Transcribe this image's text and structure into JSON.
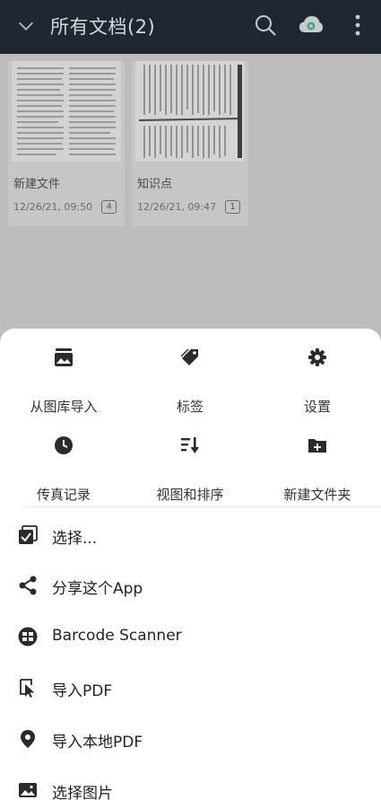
{
  "header": {
    "title": "所有文档(2)"
  },
  "documents": [
    {
      "name": "新建文件",
      "date": "12/26/21, 09:50",
      "pages": "4"
    },
    {
      "name": "知识点",
      "date": "12/26/21, 09:47",
      "pages": "1"
    }
  ],
  "sheet": {
    "grid": [
      {
        "label": "从图库导入",
        "icon": "gallery-icon"
      },
      {
        "label": "标签",
        "icon": "tag-icon"
      },
      {
        "label": "设置",
        "icon": "gear-icon"
      },
      {
        "label": "传真记录",
        "icon": "clock-icon"
      },
      {
        "label": "视图和排序",
        "icon": "sort-icon"
      },
      {
        "label": "新建文件夹",
        "icon": "new-folder-icon"
      }
    ],
    "list": [
      {
        "label": "选择...",
        "icon": "checkbox-icon"
      },
      {
        "label": "分享这个App",
        "icon": "share-icon"
      },
      {
        "label": "Barcode Scanner",
        "icon": "barcode-icon"
      },
      {
        "label": "导入PDF",
        "icon": "import-pdf-icon"
      },
      {
        "label": "导入本地PDF",
        "icon": "location-pin-icon"
      },
      {
        "label": "选择图片",
        "icon": "image-icon"
      }
    ]
  },
  "colors": {
    "appbar": "#1f2731",
    "accent_cloud": "#3bb36a",
    "icon": "#2b2b2b"
  }
}
